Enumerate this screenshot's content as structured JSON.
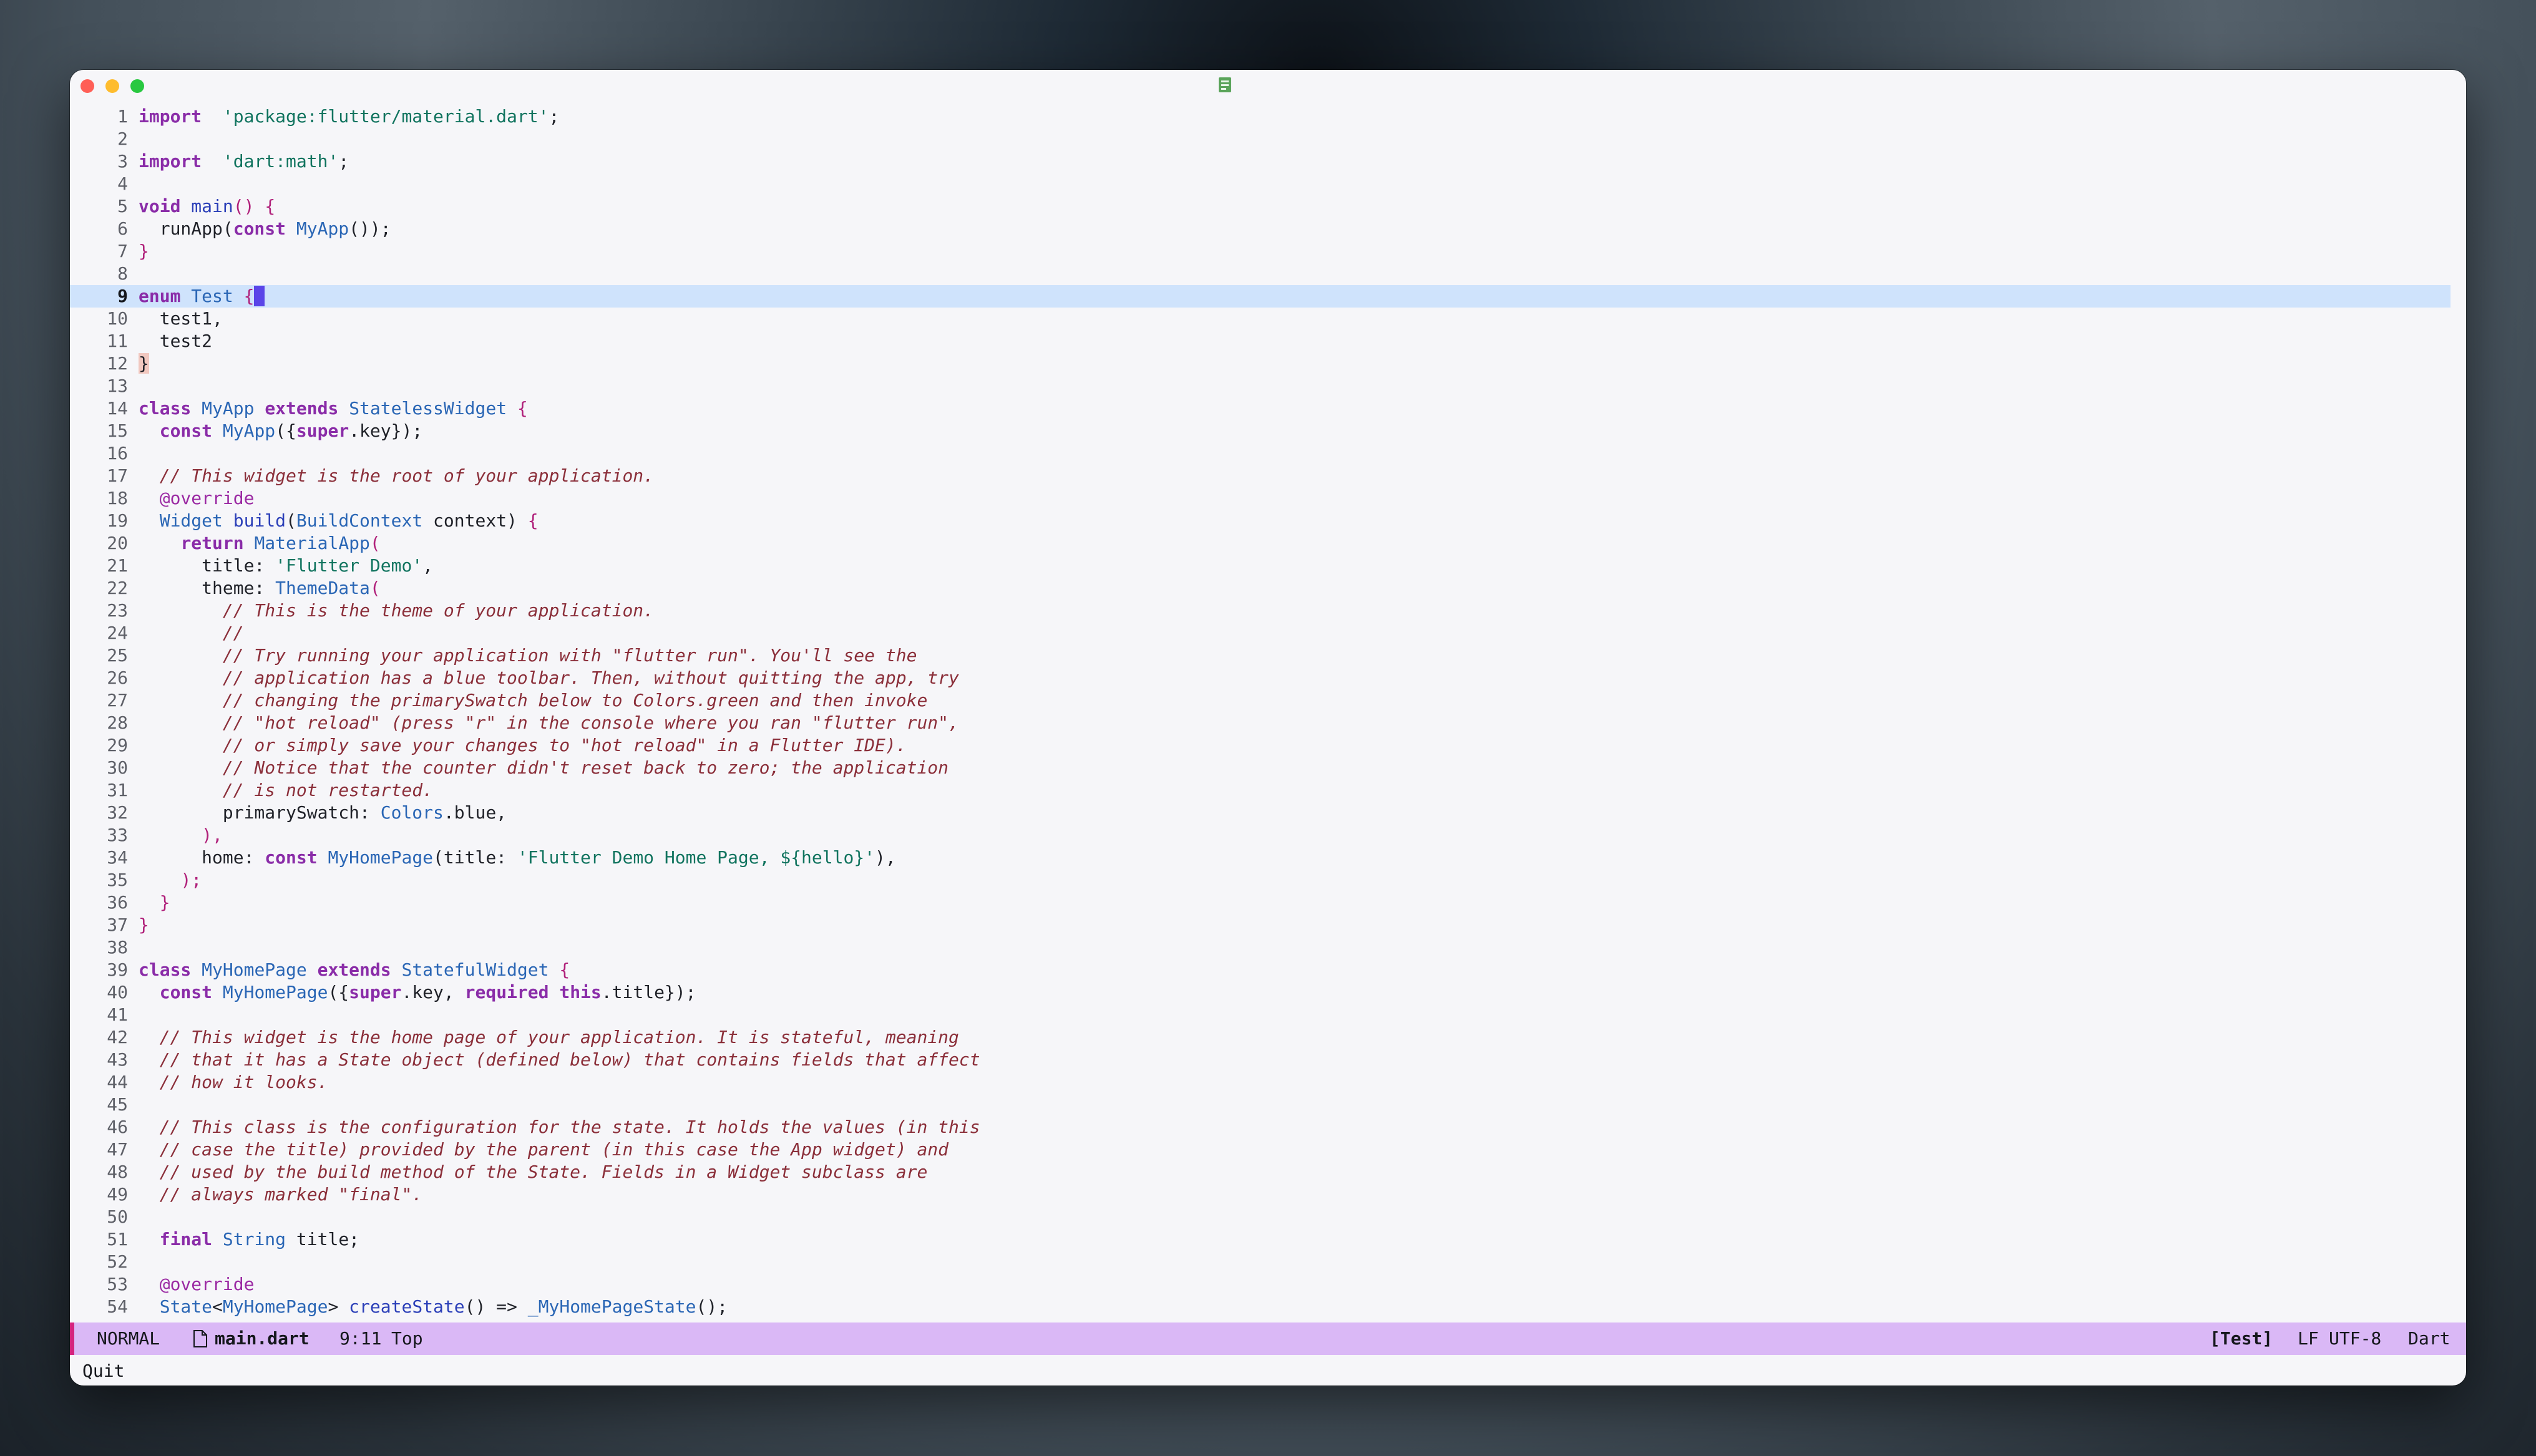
{
  "window": {
    "title_icon": "file-icon"
  },
  "editor": {
    "current_line": 9,
    "lines": [
      {
        "n": "1",
        "s": [
          [
            "kw",
            "import"
          ],
          [
            "",
            "  "
          ],
          [
            "st",
            "'package:flutter/material.dart'"
          ],
          [
            "",
            ";"
          ]
        ]
      },
      {
        "n": "2",
        "s": []
      },
      {
        "n": "3",
        "s": [
          [
            "kw",
            "import"
          ],
          [
            "",
            "  "
          ],
          [
            "st",
            "'dart:math'"
          ],
          [
            "",
            ";"
          ]
        ]
      },
      {
        "n": "4",
        "s": []
      },
      {
        "n": "5",
        "s": [
          [
            "kw",
            "void"
          ],
          [
            "",
            " "
          ],
          [
            "fn",
            "main"
          ],
          [
            "pu",
            "()"
          ],
          [
            "",
            " "
          ],
          [
            "pu",
            "{"
          ]
        ]
      },
      {
        "n": "6",
        "s": [
          [
            "",
            "  runApp("
          ],
          [
            "kw",
            "const"
          ],
          [
            "",
            " "
          ],
          [
            "ty",
            "MyApp"
          ],
          [
            "",
            "());"
          ]
        ]
      },
      {
        "n": "7",
        "s": [
          [
            "pu",
            "}"
          ]
        ]
      },
      {
        "n": "8",
        "s": []
      },
      {
        "n": "9",
        "s": [
          [
            "kw",
            "enum"
          ],
          [
            "",
            " "
          ],
          [
            "ty",
            "Test"
          ],
          [
            "",
            " "
          ],
          [
            "pu",
            "{"
          ],
          [
            "cursor",
            " "
          ]
        ]
      },
      {
        "n": "10",
        "s": [
          [
            "",
            "  test1,"
          ]
        ]
      },
      {
        "n": "11",
        "s": [
          [
            "",
            "  test2"
          ]
        ]
      },
      {
        "n": "12",
        "s": [
          [
            "match",
            "}"
          ]
        ]
      },
      {
        "n": "13",
        "s": []
      },
      {
        "n": "14",
        "s": [
          [
            "kw",
            "class"
          ],
          [
            "",
            " "
          ],
          [
            "ty",
            "MyApp"
          ],
          [
            "",
            " "
          ],
          [
            "kw",
            "extends"
          ],
          [
            "",
            " "
          ],
          [
            "ty",
            "StatelessWidget"
          ],
          [
            "",
            " "
          ],
          [
            "pu",
            "{"
          ]
        ]
      },
      {
        "n": "15",
        "s": [
          [
            "",
            "  "
          ],
          [
            "kw",
            "const"
          ],
          [
            "",
            " "
          ],
          [
            "ty",
            "MyApp"
          ],
          [
            "",
            "({"
          ],
          [
            "kw",
            "super"
          ],
          [
            "",
            ".key});"
          ]
        ]
      },
      {
        "n": "16",
        "s": []
      },
      {
        "n": "17",
        "s": [
          [
            "",
            "  "
          ],
          [
            "cm",
            "// This widget is the root of your application."
          ]
        ]
      },
      {
        "n": "18",
        "s": [
          [
            "",
            "  "
          ],
          [
            "an",
            "@override"
          ]
        ]
      },
      {
        "n": "19",
        "s": [
          [
            "",
            "  "
          ],
          [
            "ty",
            "Widget"
          ],
          [
            "",
            " "
          ],
          [
            "fn",
            "build"
          ],
          [
            "",
            "("
          ],
          [
            "ty",
            "BuildContext"
          ],
          [
            "",
            " context) "
          ],
          [
            "pu",
            "{"
          ]
        ]
      },
      {
        "n": "20",
        "s": [
          [
            "",
            "    "
          ],
          [
            "kw",
            "return"
          ],
          [
            "",
            " "
          ],
          [
            "ty",
            "MaterialApp"
          ],
          [
            "pu",
            "("
          ]
        ]
      },
      {
        "n": "21",
        "s": [
          [
            "",
            "      title: "
          ],
          [
            "st",
            "'Flutter Demo'"
          ],
          [
            "",
            ","
          ]
        ]
      },
      {
        "n": "22",
        "s": [
          [
            "",
            "      theme: "
          ],
          [
            "ty",
            "ThemeData"
          ],
          [
            "pu",
            "("
          ]
        ]
      },
      {
        "n": "23",
        "s": [
          [
            "",
            "        "
          ],
          [
            "cm",
            "// This is the theme of your application."
          ]
        ]
      },
      {
        "n": "24",
        "s": [
          [
            "",
            "        "
          ],
          [
            "cm",
            "//"
          ]
        ]
      },
      {
        "n": "25",
        "s": [
          [
            "",
            "        "
          ],
          [
            "cm",
            "// Try running your application with \"flutter run\". You'll see the"
          ]
        ]
      },
      {
        "n": "26",
        "s": [
          [
            "",
            "        "
          ],
          [
            "cm",
            "// application has a blue toolbar. Then, without quitting the app, try"
          ]
        ]
      },
      {
        "n": "27",
        "s": [
          [
            "",
            "        "
          ],
          [
            "cm",
            "// changing the primarySwatch below to Colors.green and then invoke"
          ]
        ]
      },
      {
        "n": "28",
        "s": [
          [
            "",
            "        "
          ],
          [
            "cm",
            "// \"hot reload\" (press \"r\" in the console where you ran \"flutter run\","
          ]
        ]
      },
      {
        "n": "29",
        "s": [
          [
            "",
            "        "
          ],
          [
            "cm",
            "// or simply save your changes to \"hot reload\" in a Flutter IDE)."
          ]
        ]
      },
      {
        "n": "30",
        "s": [
          [
            "",
            "        "
          ],
          [
            "cm",
            "// Notice that the counter didn't reset back to zero; the application"
          ]
        ]
      },
      {
        "n": "31",
        "s": [
          [
            "",
            "        "
          ],
          [
            "cm",
            "// is not restarted."
          ]
        ]
      },
      {
        "n": "32",
        "s": [
          [
            "",
            "        primarySwatch: "
          ],
          [
            "ty",
            "Colors"
          ],
          [
            "",
            ".blue,"
          ]
        ]
      },
      {
        "n": "33",
        "s": [
          [
            "",
            "      "
          ],
          [
            "pu",
            "),"
          ]
        ]
      },
      {
        "n": "34",
        "s": [
          [
            "",
            "      home: "
          ],
          [
            "kw",
            "const"
          ],
          [
            "",
            " "
          ],
          [
            "ty",
            "MyHomePage"
          ],
          [
            "",
            "(title: "
          ],
          [
            "st",
            "'Flutter Demo Home Page, ${hello}'"
          ],
          [
            "",
            "),"
          ]
        ]
      },
      {
        "n": "35",
        "s": [
          [
            "",
            "    "
          ],
          [
            "pu",
            ");"
          ]
        ]
      },
      {
        "n": "36",
        "s": [
          [
            "",
            "  "
          ],
          [
            "pu",
            "}"
          ]
        ]
      },
      {
        "n": "37",
        "s": [
          [
            "pu",
            "}"
          ]
        ]
      },
      {
        "n": "38",
        "s": []
      },
      {
        "n": "39",
        "s": [
          [
            "kw",
            "class"
          ],
          [
            "",
            " "
          ],
          [
            "ty",
            "MyHomePage"
          ],
          [
            "",
            " "
          ],
          [
            "kw",
            "extends"
          ],
          [
            "",
            " "
          ],
          [
            "ty",
            "StatefulWidget"
          ],
          [
            "",
            " "
          ],
          [
            "pu",
            "{"
          ]
        ]
      },
      {
        "n": "40",
        "s": [
          [
            "",
            "  "
          ],
          [
            "kw",
            "const"
          ],
          [
            "",
            " "
          ],
          [
            "ty",
            "MyHomePage"
          ],
          [
            "",
            "({"
          ],
          [
            "kw",
            "super"
          ],
          [
            "",
            ".key, "
          ],
          [
            "kw",
            "required"
          ],
          [
            "",
            " "
          ],
          [
            "kw",
            "this"
          ],
          [
            "",
            ".title});"
          ]
        ]
      },
      {
        "n": "41",
        "s": []
      },
      {
        "n": "42",
        "s": [
          [
            "",
            "  "
          ],
          [
            "cm",
            "// This widget is the home page of your application. It is stateful, meaning"
          ]
        ]
      },
      {
        "n": "43",
        "s": [
          [
            "",
            "  "
          ],
          [
            "cm",
            "// that it has a State object (defined below) that contains fields that affect"
          ]
        ]
      },
      {
        "n": "44",
        "s": [
          [
            "",
            "  "
          ],
          [
            "cm",
            "// how it looks."
          ]
        ]
      },
      {
        "n": "45",
        "s": []
      },
      {
        "n": "46",
        "s": [
          [
            "",
            "  "
          ],
          [
            "cm",
            "// This class is the configuration for the state. It holds the values (in this"
          ]
        ]
      },
      {
        "n": "47",
        "s": [
          [
            "",
            "  "
          ],
          [
            "cm",
            "// case the title) provided by the parent (in this case the App widget) and"
          ]
        ]
      },
      {
        "n": "48",
        "s": [
          [
            "",
            "  "
          ],
          [
            "cm",
            "// used by the build method of the State. Fields in a Widget subclass are"
          ]
        ]
      },
      {
        "n": "49",
        "s": [
          [
            "",
            "  "
          ],
          [
            "cm",
            "// always marked \"final\"."
          ]
        ]
      },
      {
        "n": "50",
        "s": []
      },
      {
        "n": "51",
        "s": [
          [
            "",
            "  "
          ],
          [
            "kw",
            "final"
          ],
          [
            "",
            " "
          ],
          [
            "ty",
            "String"
          ],
          [
            "",
            " title;"
          ]
        ]
      },
      {
        "n": "52",
        "s": []
      },
      {
        "n": "53",
        "s": [
          [
            "",
            "  "
          ],
          [
            "an",
            "@override"
          ]
        ]
      },
      {
        "n": "54",
        "s": [
          [
            "",
            "  "
          ],
          [
            "ty",
            "State"
          ],
          [
            "",
            "<"
          ],
          [
            "ty",
            "MyHomePage"
          ],
          [
            "",
            "> "
          ],
          [
            "fn",
            "createState"
          ],
          [
            "",
            "() => "
          ],
          [
            "ty",
            "_MyHomePageState"
          ],
          [
            "",
            "();"
          ]
        ]
      }
    ]
  },
  "statusbar": {
    "mode": "NORMAL",
    "file_icon": "file-icon",
    "filename": "main.dart",
    "position": "9:11",
    "scroll": "Top",
    "symbol": "[Test]",
    "line_ending": "LF",
    "encoding": "UTF-8",
    "language": "Dart",
    "accent_color": "#d4237e",
    "background_color": "#dab8f6"
  },
  "command_line": {
    "text": "Quit"
  }
}
